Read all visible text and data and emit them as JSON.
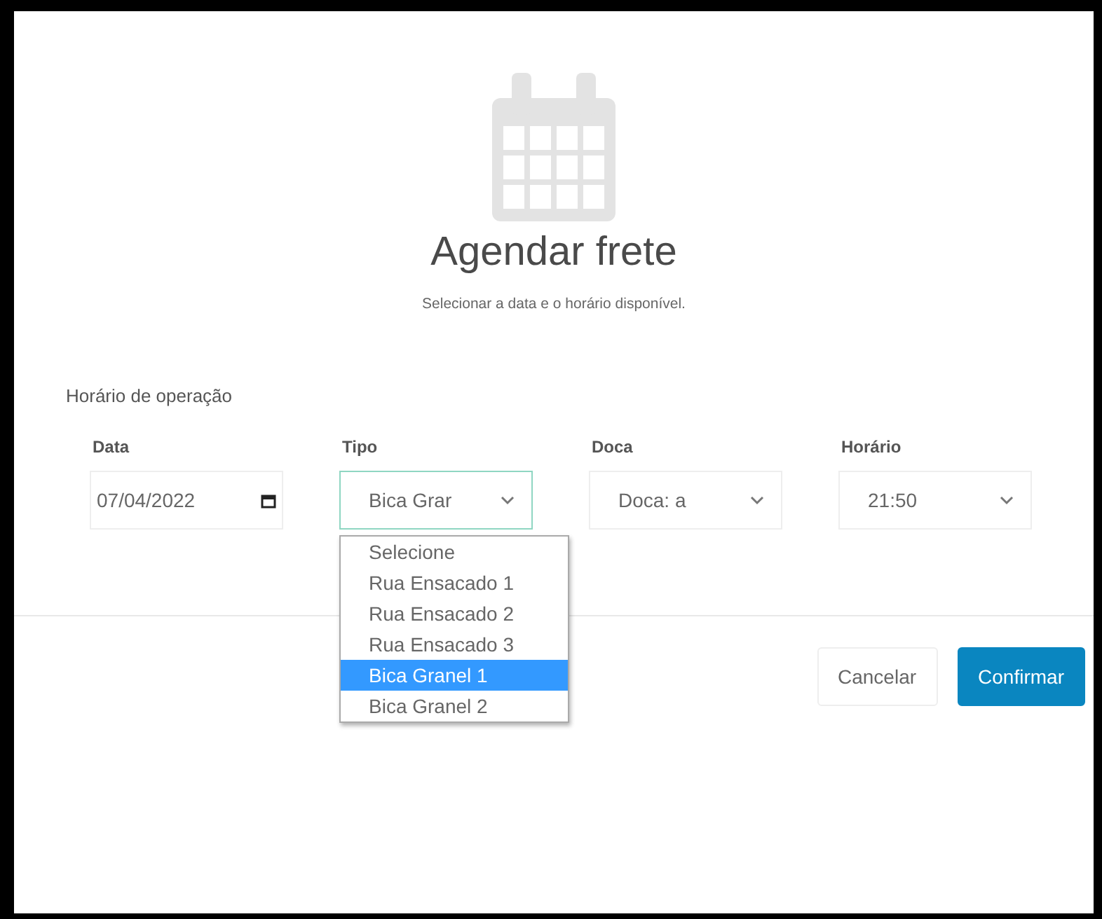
{
  "dialog": {
    "title": "Agendar frete",
    "subtitle": "Selecionar a data e o horário disponível."
  },
  "section_label": "Horário de operação",
  "fields": [
    {
      "label": "Data",
      "kind": "date",
      "value": "07/04/2022",
      "focused": false
    },
    {
      "label": "Tipo",
      "kind": "select",
      "value": "Bica Grar",
      "focused": true,
      "options": [
        {
          "label": "Selecione",
          "selected": false
        },
        {
          "label": "Rua Ensacado 1",
          "selected": false
        },
        {
          "label": "Rua Ensacado 2",
          "selected": false
        },
        {
          "label": "Rua Ensacado 3",
          "selected": false
        },
        {
          "label": "Bica Granel 1",
          "selected": true
        },
        {
          "label": "Bica Granel 2",
          "selected": false
        }
      ]
    },
    {
      "label": "Doca",
      "kind": "select",
      "value": "Doca: a",
      "focused": false
    },
    {
      "label": "Horário",
      "kind": "select",
      "value": "21:50",
      "focused": false
    }
  ],
  "buttons": [
    {
      "label": "Cancelar",
      "kind": "secondary"
    },
    {
      "label": "Confirmar",
      "kind": "primary"
    }
  ]
}
